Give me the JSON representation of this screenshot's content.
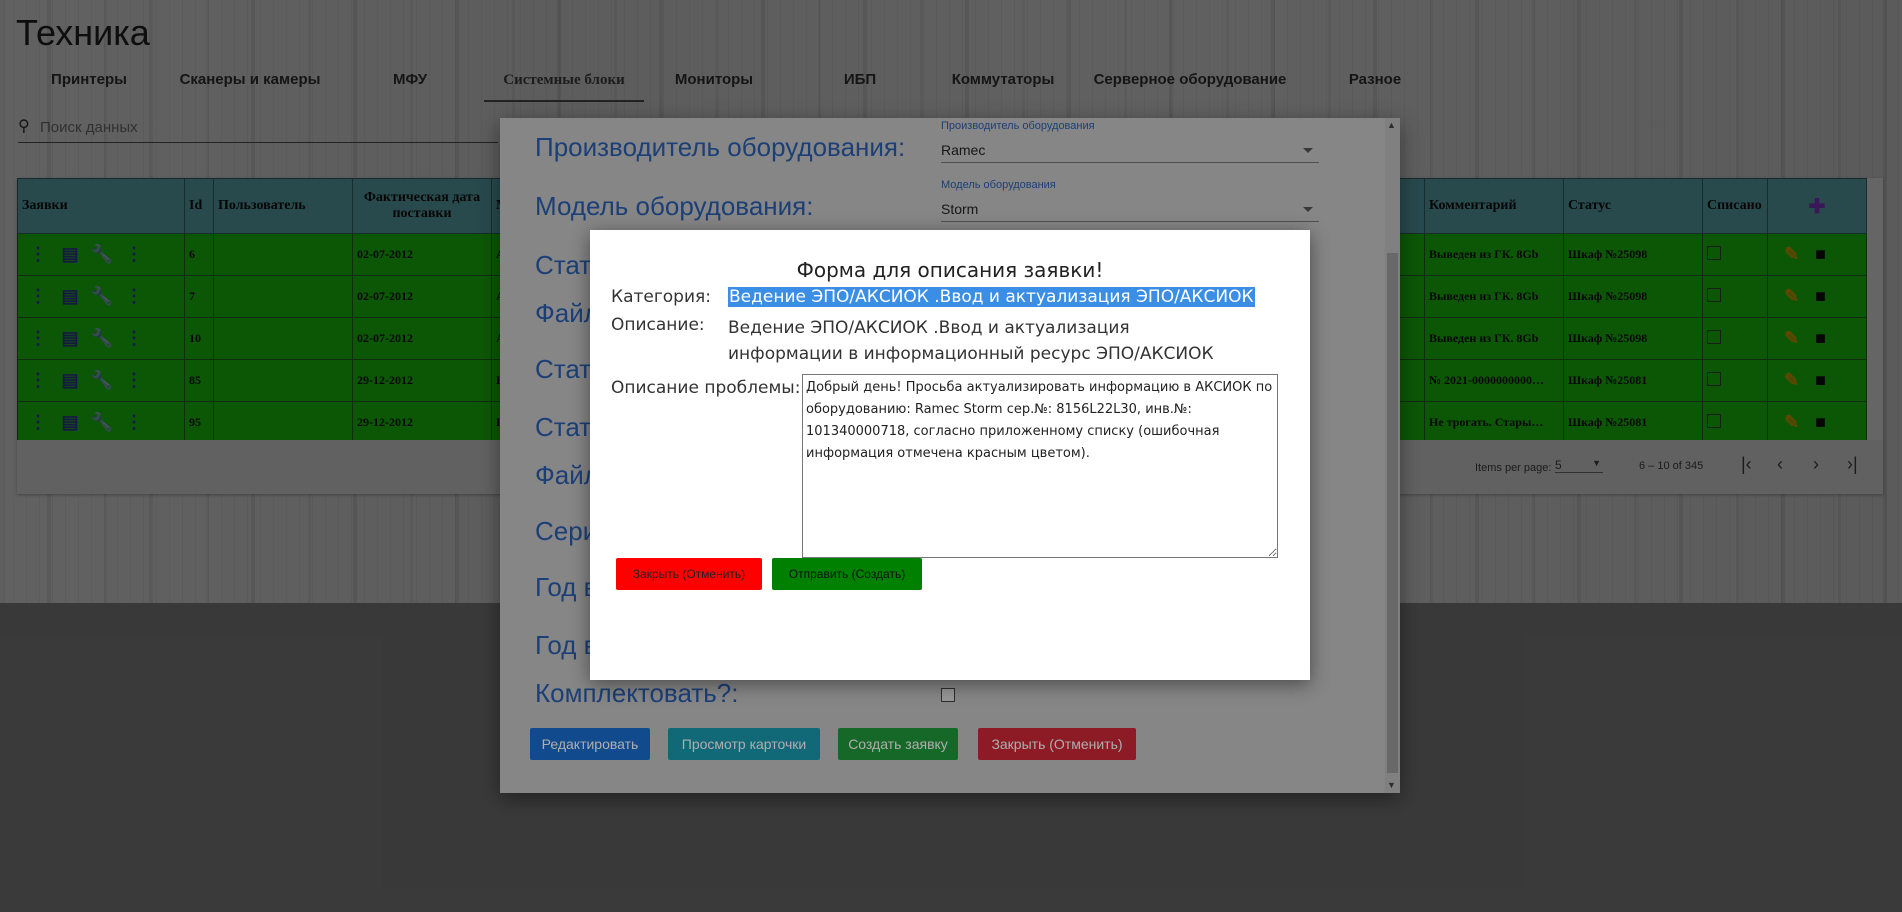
{
  "page": {
    "title": "Техника"
  },
  "tabs": [
    {
      "label": "Принтеры"
    },
    {
      "label": "Сканеры и камеры"
    },
    {
      "label": "МФУ"
    },
    {
      "label": "Системные блоки"
    },
    {
      "label": "Мониторы"
    },
    {
      "label": "ИБП"
    },
    {
      "label": "Коммутаторы"
    },
    {
      "label": "Серверное оборудование"
    },
    {
      "label": "Разное"
    }
  ],
  "search": {
    "placeholder": "Поиск данных"
  },
  "grid": {
    "headers": [
      "Заявки",
      "Id",
      "Пользователь",
      "Фактическая дата поставки",
      "М",
      "Комментарий",
      "Статус",
      "Списано"
    ],
    "rows": [
      {
        "id": "6",
        "user": "",
        "date": "02-07-2012",
        "m": "A",
        "comment": "Выведен из ГК. 8Gb",
        "status": "Шкаф №25098"
      },
      {
        "id": "7",
        "user": "",
        "date": "02-07-2012",
        "m": "A",
        "comment": "Выведен из ГК. 8Gb",
        "status": "Шкаф №25098"
      },
      {
        "id": "10",
        "user": "",
        "date": "02-07-2012",
        "m": "A",
        "comment": "Выведен из ГК. 8Gb",
        "status": "Шкаф №25098"
      },
      {
        "id": "85",
        "user": "",
        "date": "29-12-2012",
        "m": "R",
        "comment": "№ 2021-0000000000…",
        "status": "Шкаф №25081"
      },
      {
        "id": "95",
        "user": "",
        "date": "29-12-2012",
        "m": "R",
        "comment": "Не трогать. Стары…",
        "status": "Шкаф №25081"
      }
    ]
  },
  "paginator": {
    "items_per_page_label": "Items per page:",
    "items_per_page_value": "5",
    "range": "6 – 10 of 345"
  },
  "card_dialog": {
    "manufacturer_label": "Производитель оборудования:",
    "manufacturer_field_label": "Производитель оборудования",
    "manufacturer_value": "Ramec",
    "model_label": "Модель оборудования:",
    "model_field_label": "Модель оборудования",
    "model_value": "Storm",
    "status1_label": "Стату",
    "file1_label": "Файл",
    "status2_label": "Стату",
    "status3_label": "Стату",
    "file2_label": "Файл",
    "serial_label": "Сери",
    "year1_label": "Год в",
    "year2_label": "Год в",
    "complete_label": "Комплектовать?:",
    "buttons": {
      "edit": "Редактировать",
      "view_card": "Просмотр карточки",
      "create_request": "Создать заявку",
      "close": "Закрыть (Отменить)"
    }
  },
  "request_dialog": {
    "title": "Форма для описания заявки!",
    "category_label": "Категория:",
    "category_value": "Ведение ЭПО/АКСИОК .Ввод и актуализация ЭПО/АКСИОК",
    "description_label": "Описание:",
    "description_value": "Ведение ЭПО/АКСИОК .Ввод и актуализация информации в информационный ресурс ЭПО/АКСИОК",
    "problem_label": "Описание проблемы:",
    "problem_value": "Добрый день! Просьба актуализировать информацию в АКСИОК по оборудованию: Ramec Storm сер.№: 8156L22L30, инв.№: 101340000718, согласно приложенному списку (ошибочная информация отмечена красным цветом).",
    "close_button": "Закрыть (Отменить)",
    "submit_button": "Отправить (Создать)"
  },
  "colors": {
    "row_green": "#1fd010",
    "header_teal": "#5fb0b8",
    "link_blue": "#2a5eb0",
    "btn_blue": "#1a6fd0",
    "btn_teal": "#1a9ab0",
    "btn_green": "#1f9a3a",
    "btn_red": "#d02838",
    "dlg_red": "#ff0000",
    "dlg_green": "#008000"
  }
}
